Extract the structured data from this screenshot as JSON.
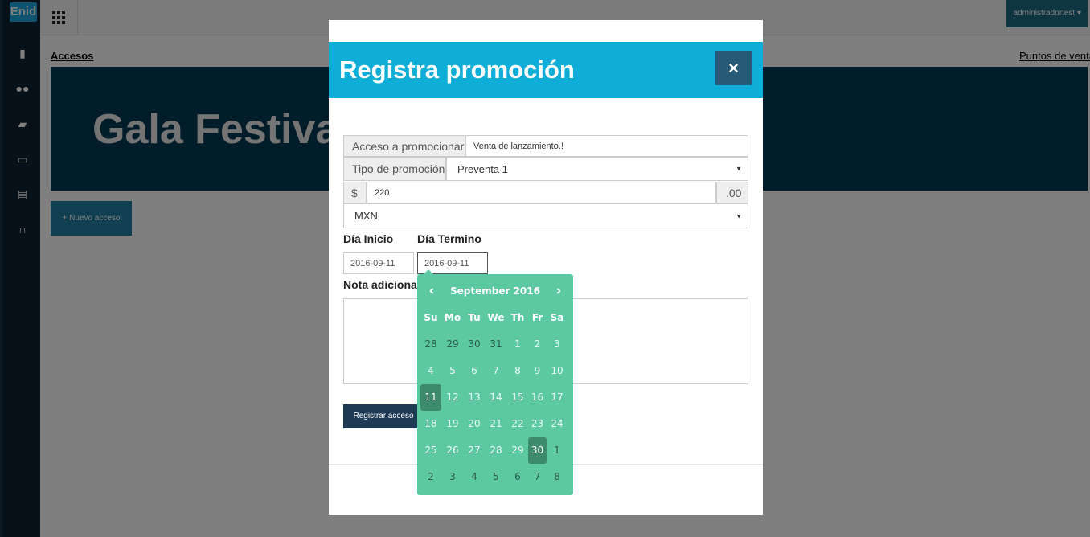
{
  "app": {
    "logo": "Enid",
    "user_menu": "administradortest",
    "breadcrumb_left": "Accesos",
    "breadcrumb_right": "Puntos de venta",
    "event_title": "Gala Festival",
    "new_access_button": "+ Nuevo acceso",
    "sidebar_icons": [
      "building-icon",
      "users-icon",
      "book-icon",
      "credit-card-icon",
      "document-icon",
      "headset-icon"
    ]
  },
  "modal": {
    "title": "Registra promoción",
    "close": "×",
    "access_label": "Acceso a promocionar",
    "access_value": "Venta de lanzamiento.!",
    "promo_type_label": "Tipo de promoción",
    "promo_type_value": "Preventa 1",
    "currency_symbol": "$",
    "price_value": "220",
    "cents_suffix": ".00",
    "currency_value": "MXN",
    "start_label": "Día Inicio",
    "end_label": "Día Termino",
    "start_value": "2016-09-11",
    "end_value": "2016-09-11",
    "note_label": "Nota adicional",
    "submit_button": "Registrar acceso"
  },
  "datepicker": {
    "prev": "‹",
    "next": "›",
    "month": "September 2016",
    "weekdays": [
      "Su",
      "Mo",
      "Tu",
      "We",
      "Th",
      "Fr",
      "Sa"
    ],
    "days": [
      [
        "28",
        "29",
        "30",
        "31",
        "1",
        "2",
        "3"
      ],
      [
        "4",
        "5",
        "6",
        "7",
        "8",
        "9",
        "10"
      ],
      [
        "11",
        "12",
        "13",
        "14",
        "15",
        "16",
        "17"
      ],
      [
        "18",
        "19",
        "20",
        "21",
        "22",
        "23",
        "24"
      ],
      [
        "25",
        "26",
        "27",
        "28",
        "29",
        "30",
        "1"
      ],
      [
        "2",
        "3",
        "4",
        "5",
        "6",
        "7",
        "8"
      ]
    ],
    "selected": [
      "11",
      "30"
    ]
  }
}
